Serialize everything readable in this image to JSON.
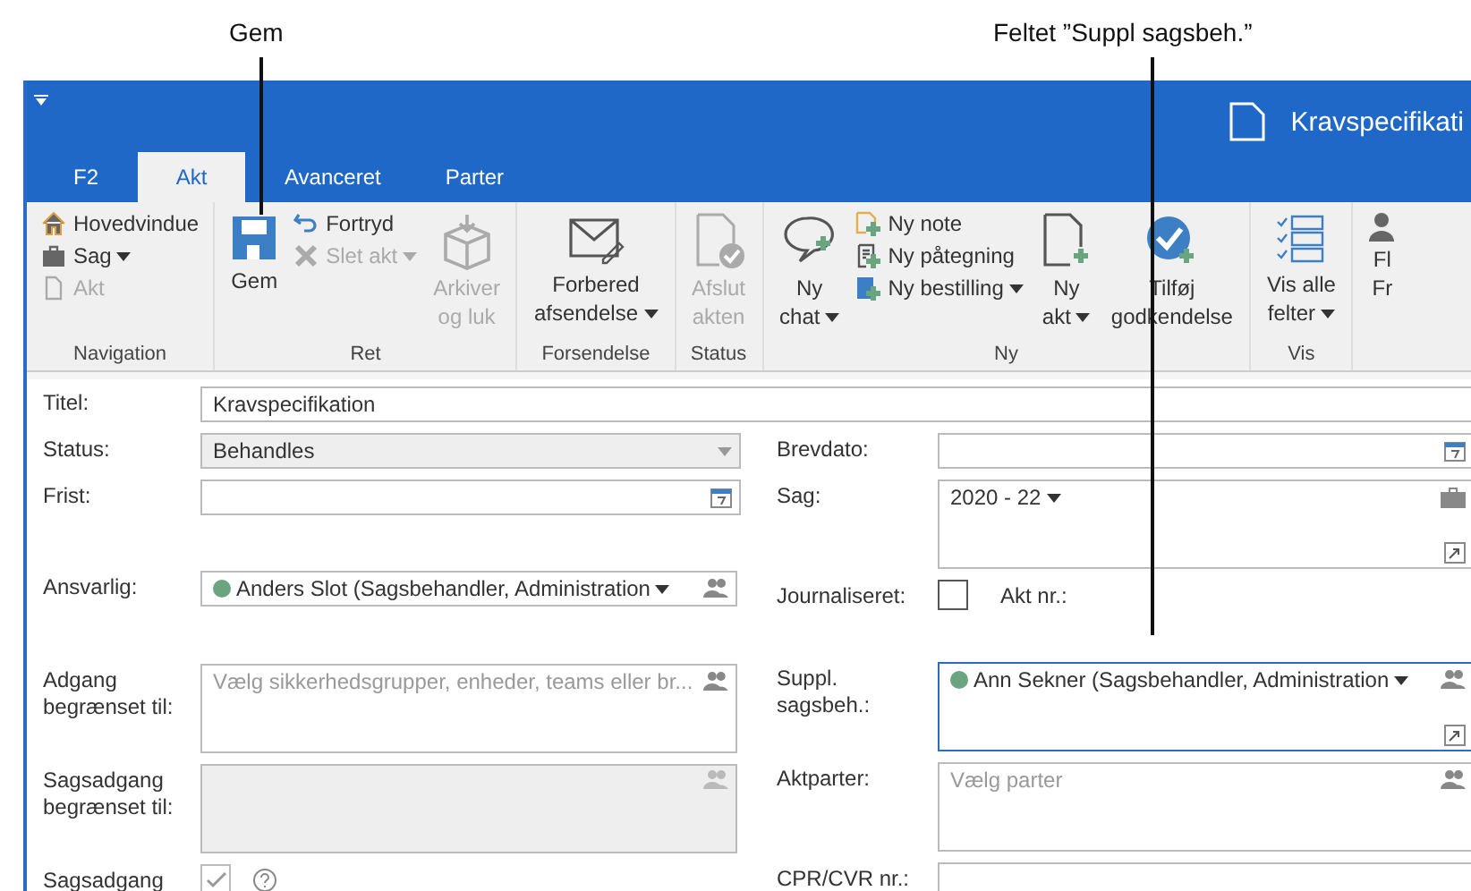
{
  "annotations": [
    {
      "text": "Gem"
    },
    {
      "text": "Feltet ”Suppl sagsbeh.”"
    }
  ],
  "window": {
    "title": "Kravspecifikati"
  },
  "tabs": [
    {
      "label": "F2",
      "selected": false
    },
    {
      "label": "Akt",
      "selected": true
    },
    {
      "label": "Avanceret",
      "selected": false
    },
    {
      "label": "Parter",
      "selected": false
    }
  ],
  "ribbon": {
    "groups": [
      {
        "label": "Navigation",
        "columns": [
          [
            {
              "kind": "small",
              "lines": [
                "Hovedvindue"
              ],
              "disabled": false,
              "menu": false
            },
            {
              "kind": "small",
              "lines": [
                "Sag"
              ],
              "disabled": false,
              "menu": true
            },
            {
              "kind": "small",
              "lines": [
                "Akt"
              ],
              "disabled": true,
              "menu": false
            }
          ]
        ]
      },
      {
        "label": "Ret",
        "columns": [
          [
            {
              "kind": "large",
              "lines": [
                "Gem"
              ],
              "disabled": false,
              "menu": false
            }
          ],
          [
            {
              "kind": "small",
              "lines": [
                "Fortryd"
              ],
              "disabled": false,
              "menu": false
            },
            {
              "kind": "small",
              "lines": [
                "Slet akt"
              ],
              "disabled": true,
              "menu": true
            }
          ],
          [
            {
              "kind": "large",
              "lines": [
                "Arkiver",
                "og luk"
              ],
              "disabled": true,
              "menu": false
            }
          ]
        ]
      },
      {
        "label": "Forsendelse",
        "columns": [
          [
            {
              "kind": "large",
              "lines": [
                "Forbered",
                "afsendelse"
              ],
              "disabled": false,
              "menu": true
            }
          ]
        ]
      },
      {
        "label": "Status",
        "columns": [
          [
            {
              "kind": "large",
              "lines": [
                "Afslut",
                "akten"
              ],
              "disabled": true,
              "menu": false
            }
          ]
        ]
      },
      {
        "label": "Ny",
        "columns": [
          [
            {
              "kind": "large",
              "lines": [
                "Ny",
                "chat"
              ],
              "disabled": false,
              "menu": true
            }
          ],
          [
            {
              "kind": "small",
              "lines": [
                "Ny note"
              ],
              "disabled": false,
              "menu": false
            },
            {
              "kind": "small",
              "lines": [
                "Ny påtegning"
              ],
              "disabled": false,
              "menu": false
            },
            {
              "kind": "small",
              "lines": [
                "Ny bestilling"
              ],
              "disabled": false,
              "menu": true
            }
          ],
          [
            {
              "kind": "large",
              "lines": [
                "Ny",
                "akt"
              ],
              "disabled": false,
              "menu": true
            }
          ],
          [
            {
              "kind": "large",
              "lines": [
                "Tilføj",
                "godkendelse"
              ],
              "disabled": false,
              "menu": false
            }
          ]
        ]
      },
      {
        "label": "Vis",
        "columns": [
          [
            {
              "kind": "large",
              "lines": [
                "Vis alle",
                "felter"
              ],
              "disabled": false,
              "menu": true
            }
          ]
        ]
      },
      {
        "columns": [
          [
            {
              "kind": "large",
              "lines": [
                "Fl",
                "Fr"
              ],
              "disabled": false,
              "menu": false
            }
          ]
        ]
      }
    ]
  },
  "form": {
    "title_field": {
      "label": "Titel:",
      "value": "Kravspecifikation"
    },
    "left": [
      {
        "kind": "dropdown",
        "label": "Status:",
        "value": "Behandles",
        "disabled": true
      },
      {
        "kind": "date",
        "label": "Frist:"
      },
      {
        "kind": "person",
        "label": "Ansvarlig:",
        "value": "Anders Slot (Sagsbehandler, Administration",
        "focused": false
      },
      {
        "kind": "picker",
        "label": "Adgang begrænset til:",
        "placeholder": "Vælg sikkerhedsgrupper, enheder, teams eller br...",
        "disabled": false
      },
      {
        "kind": "picker",
        "label": "Sagsadgang begrænset til:",
        "disabled": true
      },
      {
        "kind": "checkbox",
        "label": "Sagsadgang",
        "checked": true,
        "disabled": true,
        "help": true
      }
    ],
    "right": [
      {
        "kind": "date",
        "label": "Brevdato:"
      },
      {
        "kind": "case",
        "label": "Sag:",
        "value": "2020 - 22"
      },
      {
        "kind": "checkbox",
        "label": "Journaliseret:",
        "checked": false,
        "disabled": false,
        "extra_label": "Akt nr.:"
      },
      {
        "kind": "person",
        "label": "Suppl. sagsbeh.:",
        "value": "Ann Sekner (Sagsbehandler, Administration",
        "focused": true
      },
      {
        "kind": "picker",
        "label": "Aktparter:",
        "placeholder": "Vælg parter",
        "disabled": false
      },
      {
        "kind": "text",
        "label": "CPR/CVR nr.:"
      }
    ]
  }
}
